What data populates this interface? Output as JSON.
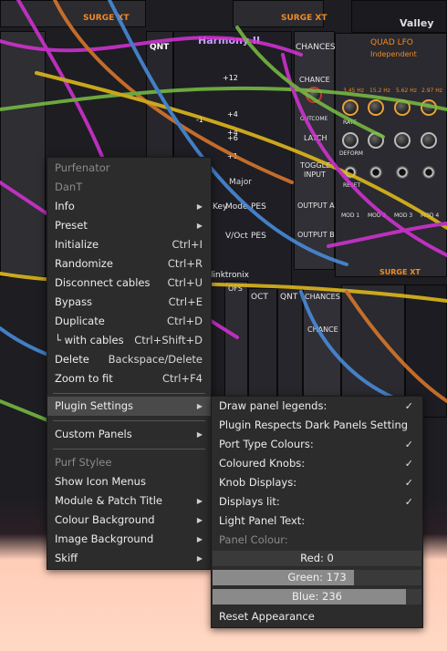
{
  "rack": {
    "modules": {
      "surge_top_1": "SURGE XT",
      "surge_top_2": "SURGE XT",
      "valley": "Valley",
      "harmony": "Harmony II",
      "qnt": "QNT",
      "chances": "CHANCES",
      "quad_lfo": "QUAD LFO",
      "quad_lfo_mode": "Independent",
      "quad_lfo_rates": [
        "3.45 Hz",
        "15.2 Hz",
        "5.62 Hz",
        "2.97 Hz"
      ],
      "surge_bottom": "SURGE XT",
      "linktronix": "linktronix",
      "major": "Major",
      "key": "Key",
      "mode": "Mode",
      "pes": "PES",
      "voct": "V/Oct",
      "oct": "OCT",
      "ofs": "OFS",
      "qnt2": "QNT",
      "chances2": "CHANCES",
      "chance_label": "CHANCE",
      "outcome": "OUTCOME",
      "latch": "LATCH",
      "toggle": "TOGGLE",
      "input": "INPUT",
      "output_a": "OUTPUT A",
      "output_b": "OUTPUT B",
      "rate": "RATE",
      "deform": "DEFORM",
      "reset": "RESET",
      "mod_labels": [
        "MOD 1",
        "MOD 2",
        "MOD 3",
        "MOD 4"
      ],
      "harmony_values": [
        "+12",
        "+4",
        "+4",
        "-1",
        "+6",
        "+1"
      ]
    }
  },
  "context_menu": {
    "items": [
      {
        "label": "Purfenator",
        "disabled": true
      },
      {
        "label": "DanT",
        "disabled": true
      },
      {
        "label": "Info",
        "submenu": true
      },
      {
        "label": "Preset",
        "submenu": true
      },
      {
        "label": "Initialize",
        "shortcut": "Ctrl+I"
      },
      {
        "label": "Randomize",
        "shortcut": "Ctrl+R"
      },
      {
        "label": "Disconnect cables",
        "shortcut": "Ctrl+U"
      },
      {
        "label": "Bypass",
        "shortcut": "Ctrl+E"
      },
      {
        "label": "Duplicate",
        "shortcut": "Ctrl+D"
      },
      {
        "label": "└ with cables",
        "shortcut": "Ctrl+Shift+D"
      },
      {
        "label": "Delete",
        "shortcut": "Backspace/Delete"
      },
      {
        "label": "Zoom to fit",
        "shortcut": "Ctrl+F4"
      },
      {
        "label": "Plugin Settings",
        "submenu": true,
        "active": true
      },
      {
        "label": "Custom Panels",
        "submenu": true
      },
      {
        "label": "Purf Stylee",
        "disabled": true
      },
      {
        "label": "Show Icon Menus"
      },
      {
        "label": "Module & Patch Title",
        "submenu": true
      },
      {
        "label": "Colour Background",
        "submenu": true
      },
      {
        "label": "Image Background",
        "submenu": true
      },
      {
        "label": "Skiff",
        "submenu": true
      }
    ]
  },
  "plugin_settings_menu": {
    "items": [
      {
        "label": "Draw panel legends:",
        "checked": true
      },
      {
        "label": "Plugin Respects Dark Panels Setting",
        "checked": false
      },
      {
        "label": "Port Type Colours:",
        "checked": true
      },
      {
        "label": "Coloured Knobs:",
        "checked": true
      },
      {
        "label": "Knob Displays:",
        "checked": true
      },
      {
        "label": "Displays lit:",
        "checked": true
      },
      {
        "label": "Light Panel Text:",
        "checked": false
      },
      {
        "label": "Panel Colour:",
        "disabled": true
      }
    ],
    "sliders": [
      {
        "label": "Red: 0",
        "value": 0,
        "max": 255
      },
      {
        "label": "Green: 173",
        "value": 173,
        "max": 255
      },
      {
        "label": "Blue: 236",
        "value": 236,
        "max": 255
      }
    ],
    "reset": "Reset Appearance",
    "check_glyph": "✓",
    "arrow_glyph": "▶"
  }
}
